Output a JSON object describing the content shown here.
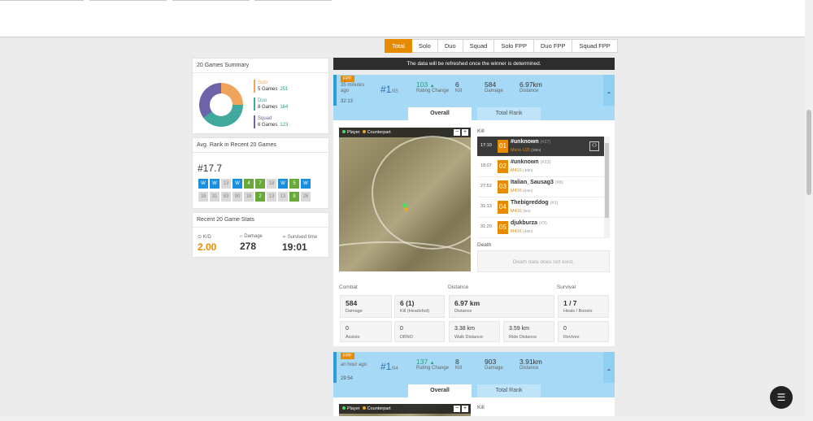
{
  "modes": [
    "Total",
    "Solo",
    "Duo",
    "Squad",
    "Solo FPP",
    "Duo FPP",
    "Squad FPP"
  ],
  "summary": {
    "title": "20 Games Summary",
    "solo": {
      "name": "Solo",
      "games": "5 Games",
      "rating": "251"
    },
    "duo": {
      "name": "Duo",
      "games": "8 Games",
      "rating": "164"
    },
    "squad": {
      "name": "Squad",
      "games": "6 Games",
      "rating": "123"
    }
  },
  "avg_rank": {
    "title": "Avg. Rank in Recent 20 Games",
    "value": "#17.7",
    "row1": [
      {
        "t": "W",
        "c": "#1a8fe0"
      },
      {
        "t": "W",
        "c": "#1a8fe0"
      },
      {
        "t": "13",
        "c": "#d9d9d9"
      },
      {
        "t": "W",
        "c": "#1a8fe0"
      },
      {
        "t": "4",
        "c": "#68a93a"
      },
      {
        "t": "7",
        "c": "#68a93a"
      },
      {
        "t": "18",
        "c": "#d9d9d9"
      },
      {
        "t": "W",
        "c": "#1a8fe0"
      },
      {
        "t": "5",
        "c": "#68a93a"
      },
      {
        "t": "W",
        "c": "#1a8fe0"
      }
    ],
    "row2": [
      {
        "t": "18",
        "c": "#d9d9d9"
      },
      {
        "t": "31",
        "c": "#d9d9d9"
      },
      {
        "t": "83",
        "c": "#d9d9d9"
      },
      {
        "t": "90",
        "c": "#d9d9d9"
      },
      {
        "t": "18",
        "c": "#d9d9d9"
      },
      {
        "t": "2",
        "c": "#68a93a"
      },
      {
        "t": "13",
        "c": "#d9d9d9"
      },
      {
        "t": "13",
        "c": "#d9d9d9"
      },
      {
        "t": "8",
        "c": "#68a93a"
      },
      {
        "t": "26",
        "c": "#d9d9d9"
      }
    ]
  },
  "recent": {
    "title": "Recent 20 Game Stats",
    "kd_label": "K/D",
    "kd": "2.00",
    "dmg_label": "Damage",
    "dmg": "278",
    "surv_label": "Survived time",
    "surv": "19:01"
  },
  "banner": "The data will be refreshed once the winner is determined.",
  "match1": {
    "mode": "FPP",
    "ago": "35 minutes ago",
    "time": "32:13",
    "rank": "#1",
    "total": "/95",
    "rating": "103",
    "rating_label": "Rating Change",
    "kill": "6",
    "kill_label": "Kill",
    "damage": "584",
    "damage_label": "Damage",
    "distance": "6.97km",
    "distance_label": "Distance"
  },
  "tabs": {
    "overall": "Overall",
    "total_rank": "Total Rank"
  },
  "legend": {
    "player": "Player",
    "counterpart": "Counterpart"
  },
  "kill_title": "Kill",
  "kills": [
    {
      "time": "17:10",
      "num": "01",
      "name": "#unknown",
      "rank": "(#27)",
      "weapon": "Micro UZI",
      "dist": "(10m)"
    },
    {
      "time": "18:07",
      "num": "02",
      "name": "#unknown",
      "rank": "(#23)",
      "weapon": "M416",
      "dist": "(10m)"
    },
    {
      "time": "27:52",
      "num": "03",
      "name": "Italian_Sausag3",
      "rank": "(#8)",
      "weapon": "M416",
      "dist": "(24m)"
    },
    {
      "time": "31:13",
      "num": "04",
      "name": "Thebigreddog",
      "rank": "(#1)",
      "weapon": "M416",
      "dist": "(5m)"
    },
    {
      "time": "31:20",
      "num": "05",
      "name": "djukburza",
      "rank": "(#3)",
      "weapon": "M416",
      "dist": "(22m)"
    }
  ],
  "death_title": "Death",
  "death_msg": "Death data does not exist.",
  "stats": {
    "combat": "Combat",
    "distance": "Distance",
    "survival": "Survival",
    "damage": "584",
    "damage_l": "Damage",
    "kill": "6 (1)",
    "kill_l": "Kill (Headshot)",
    "dist": "6.97 km",
    "dist_l": "Distance",
    "heals": "1 / 7",
    "heals_l": "Heals / Boosts",
    "assists": "0",
    "assists_l": "Assists",
    "dbno": "0",
    "dbno_l": "DBNO",
    "walk": "3.38 km",
    "walk_l": "Walk Distance",
    "ride": "3.59 km",
    "ride_l": "Ride Distance",
    "revives": "0",
    "revives_l": "Revives"
  },
  "match2": {
    "mode": "FPP",
    "ago": "an hour ago",
    "time": "29:54",
    "rank": "#1",
    "total": "/94",
    "rating": "137",
    "rating_label": "Rating Change",
    "kill": "8",
    "kill_label": "Kill",
    "damage": "903",
    "damage_label": "Damage",
    "distance": "3.91km",
    "distance_label": "Distance"
  }
}
